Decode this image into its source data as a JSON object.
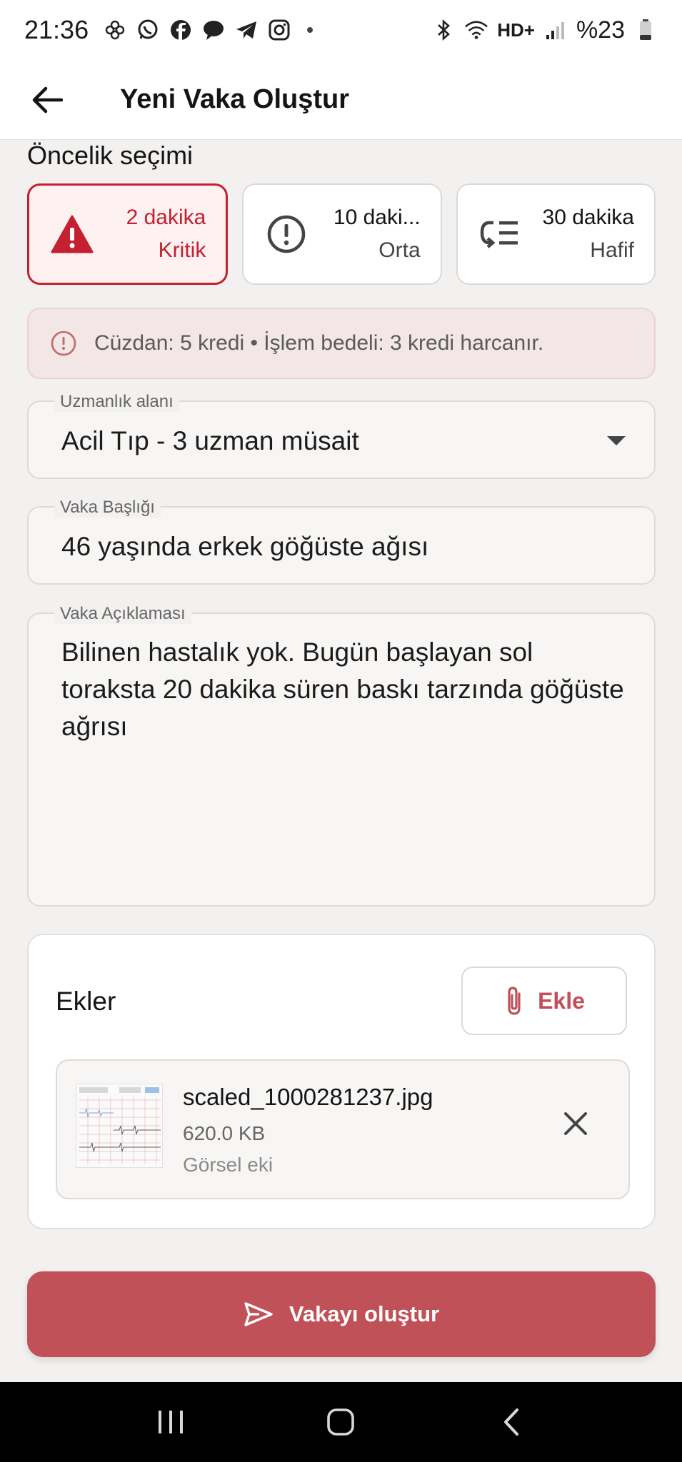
{
  "status_bar": {
    "time": "21:36",
    "battery": "%23",
    "network_label": "HD+",
    "app_icons": [
      "pinwheel-icon",
      "whatsapp-icon",
      "facebook-icon",
      "message-icon",
      "telegram-icon",
      "instagram-icon"
    ],
    "system_icons": [
      "bluetooth-icon",
      "wifi-icon",
      "signal-icon",
      "battery-icon"
    ]
  },
  "app_bar": {
    "title": "Yeni Vaka Oluştur",
    "back_icon": "arrow-left-icon"
  },
  "priority": {
    "label": "Öncelik seçimi",
    "options": [
      {
        "time": "2 dakika",
        "level": "Kritik",
        "icon": "warning-triangle-icon",
        "selected": true
      },
      {
        "time": "10 daki...",
        "level": "Orta",
        "icon": "alert-circle-icon",
        "selected": false
      },
      {
        "time": "30 dakika",
        "level": "Hafif",
        "icon": "low-priority-icon",
        "selected": false
      }
    ]
  },
  "wallet_info": {
    "icon": "info-icon",
    "text": "Cüzdan: 5 kredi • İşlem bedeli: 3 kredi harcanır."
  },
  "form": {
    "specialty": {
      "label": "Uzmanlık alanı",
      "value": "Acil Tıp - 3 uzman müsait"
    },
    "case_title": {
      "label": "Vaka Başlığı",
      "value": "46 yaşında erkek  göğüste ağısı"
    },
    "case_description": {
      "label": "Vaka Açıklaması",
      "value": "Bilinen hastalık yok. Bugün başlayan sol toraksta 20 dakika  süren baskı tarzında göğüste ağrısı"
    }
  },
  "attachments": {
    "title": "Ekler",
    "add_label": "Ekle",
    "items": [
      {
        "file_name": "scaled_1000281237.jpg",
        "size": "620.0 KB",
        "type": "Görsel eki"
      }
    ]
  },
  "submit": {
    "label": "Vakayı oluştur",
    "icon": "send-icon"
  },
  "colors": {
    "accent": "#c4202f",
    "submit_bg": "#c05158",
    "page_bg": "#f3f1f0"
  }
}
